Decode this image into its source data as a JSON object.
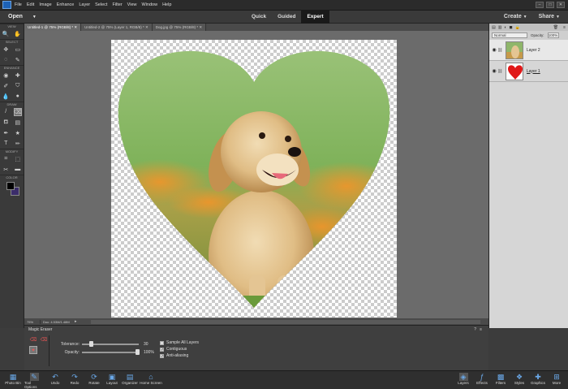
{
  "menubar": {
    "items": [
      "File",
      "Edit",
      "Image",
      "Enhance",
      "Layer",
      "Select",
      "Filter",
      "View",
      "Window",
      "Help"
    ],
    "window_buttons": [
      "–",
      "□",
      "✕"
    ]
  },
  "modebar": {
    "open_label": "Open",
    "modes": [
      "Quick",
      "Guided",
      "Expert"
    ],
    "active_mode": "Expert",
    "create_label": "Create",
    "share_label": "Share"
  },
  "tabs": [
    {
      "label": "Untitled-1 @ 75% (RGB/8) *",
      "active": true
    },
    {
      "label": "Untitled-2 @ 75% (Layer 1, RGB/8) *",
      "active": false
    },
    {
      "label": "Dog.jpg @ 75% (RGB/8) *",
      "active": false
    }
  ],
  "toolbox": {
    "sections": [
      "VIEW",
      "SELECT",
      "ENHANCE",
      "DRAW",
      "MODIFY",
      "COLOR"
    ]
  },
  "statusbar": {
    "zoom": "75%",
    "doc": "Doc: 4.53M/1.48M"
  },
  "layers_panel": {
    "blend_mode": "Normal",
    "opacity_label": "Opacity:",
    "opacity_value": "100%",
    "layers": [
      {
        "name": "Layer 2",
        "underlined": false
      },
      {
        "name": "Layer 1",
        "underlined": true
      }
    ]
  },
  "tool_options": {
    "tool_name": "Magic Eraser",
    "tolerance_label": "Tolerance:",
    "tolerance_value": "30",
    "tolerance_level": 0.15,
    "opacity_label": "Opacity:",
    "opacity_value": "100%",
    "opacity_level": 1.0,
    "checkboxes": [
      {
        "label": "Sample All Layers",
        "checked": false
      },
      {
        "label": "Contiguous",
        "checked": true
      },
      {
        "label": "Anti-aliasing",
        "checked": true
      }
    ]
  },
  "taskbar": {
    "left": [
      "Photo Bin",
      "Tool Options",
      "Undo",
      "Redo",
      "Rotate",
      "Layout",
      "Organizer",
      "Home Screen"
    ],
    "right": [
      "Layers",
      "Effects",
      "Filters",
      "Styles",
      "Graphics",
      "More"
    ]
  },
  "colors": {
    "accent": "#1d62b6",
    "foreground_swatch": "#000000",
    "background_swatch": "#3b2d6a",
    "heart_layer": "#e01818"
  }
}
